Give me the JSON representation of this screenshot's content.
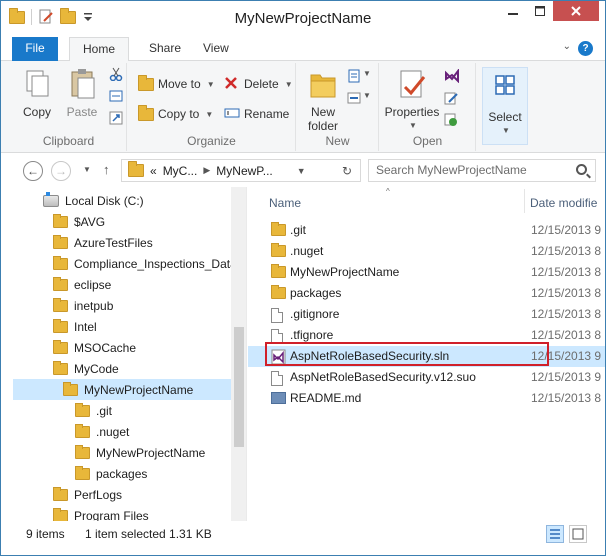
{
  "window": {
    "title": "MyNewProjectName"
  },
  "ribbon": {
    "tabs": {
      "file": "File",
      "home": "Home",
      "share": "Share",
      "view": "View"
    },
    "groups": {
      "clipboard": {
        "label": "Clipboard",
        "copy": "Copy",
        "paste": "Paste"
      },
      "organize": {
        "label": "Organize",
        "move_to": "Move to",
        "delete": "Delete",
        "copy_to": "Copy to",
        "rename": "Rename"
      },
      "new": {
        "label": "New",
        "new_folder": "New\nfolder"
      },
      "open": {
        "label": "Open",
        "properties": "Properties"
      },
      "select": {
        "label": "Select"
      }
    }
  },
  "address": {
    "breadcrumbs": [
      "«",
      "MyC...",
      "MyNewP..."
    ],
    "search_placeholder": "Search MyNewProjectName"
  },
  "nav_tree": [
    {
      "label": "Local Disk (C:)",
      "icon": "disk-icon",
      "level": 0
    },
    {
      "label": "$AVG",
      "icon": "folder-icon",
      "level": 1
    },
    {
      "label": "AzureTestFiles",
      "icon": "folder-icon",
      "level": 1
    },
    {
      "label": "Compliance_Inspections_Data",
      "icon": "folder-icon",
      "level": 1
    },
    {
      "label": "eclipse",
      "icon": "folder-icon",
      "level": 1
    },
    {
      "label": "inetpub",
      "icon": "folder-icon",
      "level": 1
    },
    {
      "label": "Intel",
      "icon": "folder-icon",
      "level": 1
    },
    {
      "label": "MSOCache",
      "icon": "folder-icon",
      "level": 1
    },
    {
      "label": "MyCode",
      "icon": "folder-icon",
      "level": 1
    },
    {
      "label": "MyNewProjectName",
      "icon": "folder-icon",
      "level": 2,
      "selected": true
    },
    {
      "label": ".git",
      "icon": "folder-icon",
      "level": 3
    },
    {
      "label": ".nuget",
      "icon": "folder-icon",
      "level": 3
    },
    {
      "label": "MyNewProjectName",
      "icon": "folder-icon",
      "level": 3
    },
    {
      "label": "packages",
      "icon": "folder-icon",
      "level": 3
    },
    {
      "label": "PerfLogs",
      "icon": "folder-icon",
      "level": 1
    },
    {
      "label": "Program Files",
      "icon": "folder-icon",
      "level": 1
    }
  ],
  "file_list": {
    "columns": {
      "name": "Name",
      "date": "Date modifie"
    },
    "rows": [
      {
        "name": ".git",
        "icon": "folder-icon",
        "date": "12/15/2013 9"
      },
      {
        "name": ".nuget",
        "icon": "folder-icon",
        "date": "12/15/2013 8"
      },
      {
        "name": "MyNewProjectName",
        "icon": "folder-icon",
        "date": "12/15/2013 8"
      },
      {
        "name": "packages",
        "icon": "folder-icon",
        "date": "12/15/2013 8"
      },
      {
        "name": ".gitignore",
        "icon": "file-icon",
        "date": "12/15/2013 8"
      },
      {
        "name": ".tfignore",
        "icon": "file-icon",
        "date": "12/15/2013 8"
      },
      {
        "name": "AspNetRoleBasedSecurity.sln",
        "icon": "visual-studio-solution-icon",
        "date": "12/15/2013 9",
        "selected": true
      },
      {
        "name": "AspNetRoleBasedSecurity.v12.suo",
        "icon": "file-icon",
        "date": "12/15/2013 9"
      },
      {
        "name": "README.md",
        "icon": "markdown-file-icon",
        "date": "12/15/2013 8"
      }
    ]
  },
  "status": {
    "item_count": "9 items",
    "selection": "1 item selected  1.31 KB"
  },
  "colors": {
    "accent": "#1979ca",
    "selection": "#cce8ff",
    "highlight_box": "#d0202a",
    "folder": "#e8b73a"
  }
}
